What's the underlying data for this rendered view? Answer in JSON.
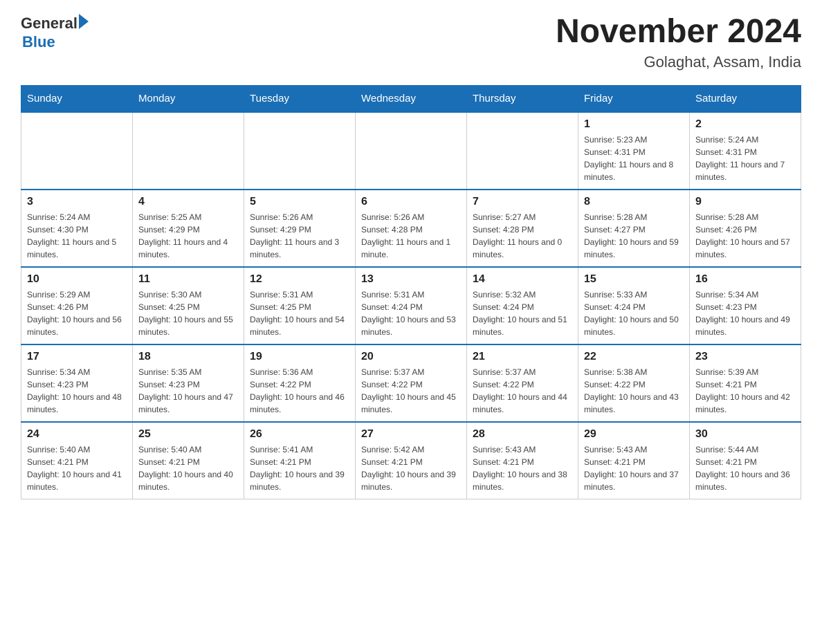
{
  "header": {
    "logo_general": "General",
    "logo_blue": "Blue",
    "month_title": "November 2024",
    "location": "Golaghat, Assam, India"
  },
  "days_of_week": [
    "Sunday",
    "Monday",
    "Tuesday",
    "Wednesday",
    "Thursday",
    "Friday",
    "Saturday"
  ],
  "weeks": [
    [
      {
        "day": "",
        "info": ""
      },
      {
        "day": "",
        "info": ""
      },
      {
        "day": "",
        "info": ""
      },
      {
        "day": "",
        "info": ""
      },
      {
        "day": "",
        "info": ""
      },
      {
        "day": "1",
        "info": "Sunrise: 5:23 AM\nSunset: 4:31 PM\nDaylight: 11 hours and 8 minutes."
      },
      {
        "day": "2",
        "info": "Sunrise: 5:24 AM\nSunset: 4:31 PM\nDaylight: 11 hours and 7 minutes."
      }
    ],
    [
      {
        "day": "3",
        "info": "Sunrise: 5:24 AM\nSunset: 4:30 PM\nDaylight: 11 hours and 5 minutes."
      },
      {
        "day": "4",
        "info": "Sunrise: 5:25 AM\nSunset: 4:29 PM\nDaylight: 11 hours and 4 minutes."
      },
      {
        "day": "5",
        "info": "Sunrise: 5:26 AM\nSunset: 4:29 PM\nDaylight: 11 hours and 3 minutes."
      },
      {
        "day": "6",
        "info": "Sunrise: 5:26 AM\nSunset: 4:28 PM\nDaylight: 11 hours and 1 minute."
      },
      {
        "day": "7",
        "info": "Sunrise: 5:27 AM\nSunset: 4:28 PM\nDaylight: 11 hours and 0 minutes."
      },
      {
        "day": "8",
        "info": "Sunrise: 5:28 AM\nSunset: 4:27 PM\nDaylight: 10 hours and 59 minutes."
      },
      {
        "day": "9",
        "info": "Sunrise: 5:28 AM\nSunset: 4:26 PM\nDaylight: 10 hours and 57 minutes."
      }
    ],
    [
      {
        "day": "10",
        "info": "Sunrise: 5:29 AM\nSunset: 4:26 PM\nDaylight: 10 hours and 56 minutes."
      },
      {
        "day": "11",
        "info": "Sunrise: 5:30 AM\nSunset: 4:25 PM\nDaylight: 10 hours and 55 minutes."
      },
      {
        "day": "12",
        "info": "Sunrise: 5:31 AM\nSunset: 4:25 PM\nDaylight: 10 hours and 54 minutes."
      },
      {
        "day": "13",
        "info": "Sunrise: 5:31 AM\nSunset: 4:24 PM\nDaylight: 10 hours and 53 minutes."
      },
      {
        "day": "14",
        "info": "Sunrise: 5:32 AM\nSunset: 4:24 PM\nDaylight: 10 hours and 51 minutes."
      },
      {
        "day": "15",
        "info": "Sunrise: 5:33 AM\nSunset: 4:24 PM\nDaylight: 10 hours and 50 minutes."
      },
      {
        "day": "16",
        "info": "Sunrise: 5:34 AM\nSunset: 4:23 PM\nDaylight: 10 hours and 49 minutes."
      }
    ],
    [
      {
        "day": "17",
        "info": "Sunrise: 5:34 AM\nSunset: 4:23 PM\nDaylight: 10 hours and 48 minutes."
      },
      {
        "day": "18",
        "info": "Sunrise: 5:35 AM\nSunset: 4:23 PM\nDaylight: 10 hours and 47 minutes."
      },
      {
        "day": "19",
        "info": "Sunrise: 5:36 AM\nSunset: 4:22 PM\nDaylight: 10 hours and 46 minutes."
      },
      {
        "day": "20",
        "info": "Sunrise: 5:37 AM\nSunset: 4:22 PM\nDaylight: 10 hours and 45 minutes."
      },
      {
        "day": "21",
        "info": "Sunrise: 5:37 AM\nSunset: 4:22 PM\nDaylight: 10 hours and 44 minutes."
      },
      {
        "day": "22",
        "info": "Sunrise: 5:38 AM\nSunset: 4:22 PM\nDaylight: 10 hours and 43 minutes."
      },
      {
        "day": "23",
        "info": "Sunrise: 5:39 AM\nSunset: 4:21 PM\nDaylight: 10 hours and 42 minutes."
      }
    ],
    [
      {
        "day": "24",
        "info": "Sunrise: 5:40 AM\nSunset: 4:21 PM\nDaylight: 10 hours and 41 minutes."
      },
      {
        "day": "25",
        "info": "Sunrise: 5:40 AM\nSunset: 4:21 PM\nDaylight: 10 hours and 40 minutes."
      },
      {
        "day": "26",
        "info": "Sunrise: 5:41 AM\nSunset: 4:21 PM\nDaylight: 10 hours and 39 minutes."
      },
      {
        "day": "27",
        "info": "Sunrise: 5:42 AM\nSunset: 4:21 PM\nDaylight: 10 hours and 39 minutes."
      },
      {
        "day": "28",
        "info": "Sunrise: 5:43 AM\nSunset: 4:21 PM\nDaylight: 10 hours and 38 minutes."
      },
      {
        "day": "29",
        "info": "Sunrise: 5:43 AM\nSunset: 4:21 PM\nDaylight: 10 hours and 37 minutes."
      },
      {
        "day": "30",
        "info": "Sunrise: 5:44 AM\nSunset: 4:21 PM\nDaylight: 10 hours and 36 minutes."
      }
    ]
  ]
}
